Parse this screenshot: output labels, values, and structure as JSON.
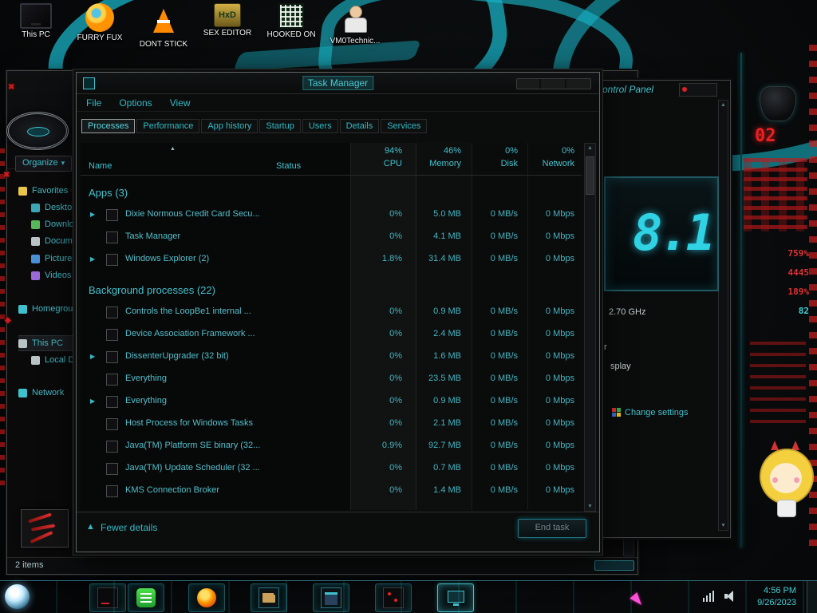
{
  "colors": {
    "accent": "#2fb9c5",
    "red": "#e03131"
  },
  "desktop": {
    "icons": [
      {
        "label": "This PC",
        "icon": "computer-icon"
      },
      {
        "label": "FURRY FUX",
        "icon": "firefox-icon"
      },
      {
        "label": "DONT STICK",
        "icon": "traffic-cone-icon"
      },
      {
        "label": "SEX EDITOR",
        "icon": "hex-editor-icon",
        "icon_text": "HxD"
      },
      {
        "label": "HOOKED ON",
        "icon": "maze-icon"
      },
      {
        "label": "VM0Technic...",
        "icon": "doctor-icon"
      }
    ]
  },
  "explorer": {
    "organize_label": "Organize",
    "status_text": "2 items",
    "sidebar": [
      {
        "label": "Favorites"
      },
      {
        "label": "Desktop",
        "indent": 1
      },
      {
        "label": "Downloads",
        "indent": 1
      },
      {
        "label": "Documents",
        "indent": 1
      },
      {
        "label": "Pictures",
        "indent": 1
      },
      {
        "label": "Videos",
        "indent": 1
      },
      {
        "label": "Homegroup"
      },
      {
        "label": "This PC",
        "selected": true
      },
      {
        "label": "Local Disk",
        "indent": 1
      },
      {
        "label": "Network"
      }
    ]
  },
  "system_window": {
    "title_partial": "ontrol Panel",
    "version_big": "8.1",
    "cpu_speed": "2.70 GHz",
    "partial_text_1": "r",
    "partial_text_2": "splay",
    "change_settings_label": "Change settings"
  },
  "task_manager": {
    "title": "Task Manager",
    "menu": [
      "File",
      "Options",
      "View"
    ],
    "tabs": [
      {
        "label": "Processes",
        "active": true
      },
      {
        "label": "Performance"
      },
      {
        "label": "App history"
      },
      {
        "label": "Startup"
      },
      {
        "label": "Users"
      },
      {
        "label": "Details"
      },
      {
        "label": "Services"
      }
    ],
    "columns": {
      "name": "Name",
      "status": "Status",
      "cpu_pct": "94%",
      "cpu": "CPU",
      "mem_pct": "46%",
      "memory": "Memory",
      "disk_pct": "0%",
      "disk": "Disk",
      "net_pct": "0%",
      "network": "Network"
    },
    "groups": [
      {
        "heading": "Apps (3)",
        "rows": [
          {
            "name": "Dixie Normous Credit Card Secu...",
            "expand": true,
            "cpu": "0%",
            "mem": "5.0 MB",
            "disk": "0 MB/s",
            "net": "0 Mbps"
          },
          {
            "name": "Task Manager",
            "cpu": "0%",
            "mem": "4.1 MB",
            "disk": "0 MB/s",
            "net": "0 Mbps"
          },
          {
            "name": "Windows Explorer (2)",
            "expand": true,
            "cpu": "1.8%",
            "mem": "31.4 MB",
            "disk": "0 MB/s",
            "net": "0 Mbps"
          }
        ]
      },
      {
        "heading": "Background processes (22)",
        "rows": [
          {
            "name": "Controls the LoopBe1 internal ...",
            "cpu": "0%",
            "mem": "0.9 MB",
            "disk": "0 MB/s",
            "net": "0 Mbps"
          },
          {
            "name": "Device Association Framework ...",
            "cpu": "0%",
            "mem": "2.4 MB",
            "disk": "0 MB/s",
            "net": "0 Mbps"
          },
          {
            "name": "DissenterUpgrader (32 bit)",
            "expand": true,
            "cpu": "0%",
            "mem": "1.6 MB",
            "disk": "0 MB/s",
            "net": "0 Mbps"
          },
          {
            "name": "Everything",
            "cpu": "0%",
            "mem": "23.5 MB",
            "disk": "0 MB/s",
            "net": "0 Mbps"
          },
          {
            "name": "Everything",
            "expand": true,
            "cpu": "0%",
            "mem": "0.9 MB",
            "disk": "0 MB/s",
            "net": "0 Mbps"
          },
          {
            "name": "Host Process for Windows Tasks",
            "cpu": "0%",
            "mem": "2.1 MB",
            "disk": "0 MB/s",
            "net": "0 Mbps"
          },
          {
            "name": "Java(TM) Platform SE binary (32...",
            "cpu": "0.9%",
            "mem": "92.7 MB",
            "disk": "0 MB/s",
            "net": "0 Mbps"
          },
          {
            "name": "Java(TM) Update Scheduler (32 ...",
            "cpu": "0%",
            "mem": "0.7 MB",
            "disk": "0 MB/s",
            "net": "0 Mbps"
          },
          {
            "name": "KMS Connection Broker",
            "cpu": "0%",
            "mem": "1.4 MB",
            "disk": "0 MB/s",
            "net": "0 Mbps"
          }
        ]
      }
    ],
    "footer": {
      "fewer_details": "Fewer details",
      "end_task": "End task"
    }
  },
  "right_widgets": {
    "counter": "02",
    "stats": [
      {
        "value": "759%",
        "color": "#e03131"
      },
      {
        "value": "4445",
        "color": "#e03131"
      },
      {
        "value": "189%",
        "color": "#e03131"
      },
      {
        "value": "82",
        "color": "#3fd0d8"
      }
    ]
  },
  "taskbar": {
    "time": "4:56 PM",
    "date": "9/26/2023",
    "icons": [
      {
        "icon": "app-dark-icon",
        "kind": "dark"
      },
      {
        "icon": "chat-icon",
        "kind": "green"
      },
      {
        "icon": "firefox-icon",
        "kind": "firefox"
      },
      {
        "icon": "folder-icon",
        "kind": "folder"
      },
      {
        "icon": "window-icon",
        "kind": "blue"
      },
      {
        "icon": "media-icon",
        "kind": "reddark"
      },
      {
        "icon": "system-monitor-icon",
        "kind": "monitor",
        "active": true
      }
    ]
  }
}
